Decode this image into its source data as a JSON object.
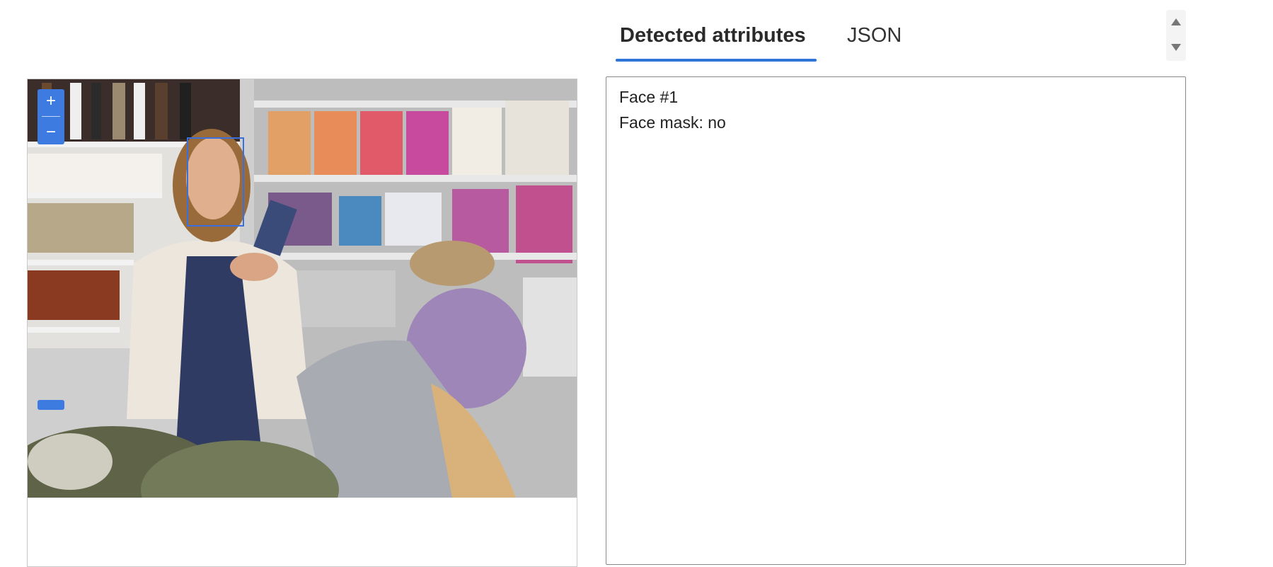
{
  "viewer": {
    "zoom_in_label": "+",
    "zoom_out_label": "−",
    "face_box_color": "#3a6fe0",
    "accent_color": "#3d7be0"
  },
  "tabs": [
    {
      "label": "Detected attributes",
      "active": true
    },
    {
      "label": "JSON",
      "active": false
    }
  ],
  "results": {
    "lines": [
      "Face #1",
      "Face mask: no"
    ]
  },
  "icons": {
    "scroll_up": "triangle-up-icon",
    "scroll_down": "triangle-down-icon"
  }
}
